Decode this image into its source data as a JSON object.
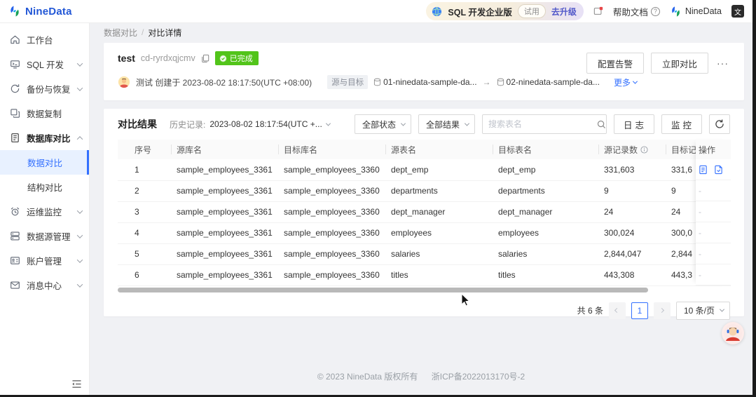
{
  "topbar": {
    "brand": "NineData",
    "plan_label": "SQL 开发企业版",
    "trial_badge": "试用",
    "upgrade_link": "去升级",
    "help_label": "帮助文档",
    "account_name": "NineData",
    "lang_glyph": "文"
  },
  "sidebar": {
    "items": [
      {
        "label": "工作台"
      },
      {
        "label": "SQL 开发"
      },
      {
        "label": "备份与恢复"
      },
      {
        "label": "数据复制"
      },
      {
        "label": "数据库对比"
      },
      {
        "label": "数据对比"
      },
      {
        "label": "结构对比"
      },
      {
        "label": "运维监控"
      },
      {
        "label": "数据源管理"
      },
      {
        "label": "账户管理"
      },
      {
        "label": "消息中心"
      }
    ]
  },
  "breadcrumb": {
    "level1": "数据对比",
    "separator": "/",
    "level2": "对比详情"
  },
  "task": {
    "name": "test",
    "id": "cd-ryrdxqjcmv",
    "status": "已完成",
    "creator_line": "测试 创建于 2023-08-02 18:17:50(UTC +08:00)",
    "source_target_label": "源与目标",
    "source_ds": "01-ninedata-sample-da...",
    "arrow": "→",
    "target_ds": "02-ninedata-sample-da...",
    "more_link": "更多",
    "config_alert_btn": "配置告警",
    "compare_now_btn": "立即对比",
    "more_btn": "···"
  },
  "results": {
    "title": "对比结果",
    "history_label": "历史记录:",
    "history_value": "2023-08-02 18:17:54(UTC +...",
    "status_filter": "全部状态",
    "result_filter": "全部结果",
    "search_placeholder": "搜索表名",
    "logs_btn": "日志",
    "monitor_btn": "监控",
    "table": {
      "headers": [
        "序号",
        "源库名",
        "目标库名",
        "源表名",
        "目标表名",
        "源记录数",
        "目标记",
        "操作"
      ],
      "rows": [
        {
          "no": "1",
          "source_db": "sample_employees_3361",
          "target_db": "sample_employees_3360",
          "source_table": "dept_emp",
          "target_table": "dept_emp",
          "source_records": "331,603",
          "target_records": "331,6",
          "actions": "icons"
        },
        {
          "no": "2",
          "source_db": "sample_employees_3361",
          "target_db": "sample_employees_3360",
          "source_table": "departments",
          "target_table": "departments",
          "source_records": "9",
          "target_records": "9",
          "actions": "-"
        },
        {
          "no": "3",
          "source_db": "sample_employees_3361",
          "target_db": "sample_employees_3360",
          "source_table": "dept_manager",
          "target_table": "dept_manager",
          "source_records": "24",
          "target_records": "24",
          "actions": "-"
        },
        {
          "no": "4",
          "source_db": "sample_employees_3361",
          "target_db": "sample_employees_3360",
          "source_table": "employees",
          "target_table": "employees",
          "source_records": "300,024",
          "target_records": "300,0",
          "actions": "-"
        },
        {
          "no": "5",
          "source_db": "sample_employees_3361",
          "target_db": "sample_employees_3360",
          "source_table": "salaries",
          "target_table": "salaries",
          "source_records": "2,844,047",
          "target_records": "2,844",
          "actions": "-"
        },
        {
          "no": "6",
          "source_db": "sample_employees_3361",
          "target_db": "sample_employees_3360",
          "source_table": "titles",
          "target_table": "titles",
          "source_records": "443,308",
          "target_records": "443,3",
          "actions": "-"
        }
      ]
    },
    "pagination": {
      "total": "共 6 条",
      "current_page": "1",
      "page_size": "10 条/页"
    }
  },
  "footer": {
    "copyright": "© 2023 NineData 版权所有",
    "icp": "浙ICP备2022013170号-2"
  }
}
